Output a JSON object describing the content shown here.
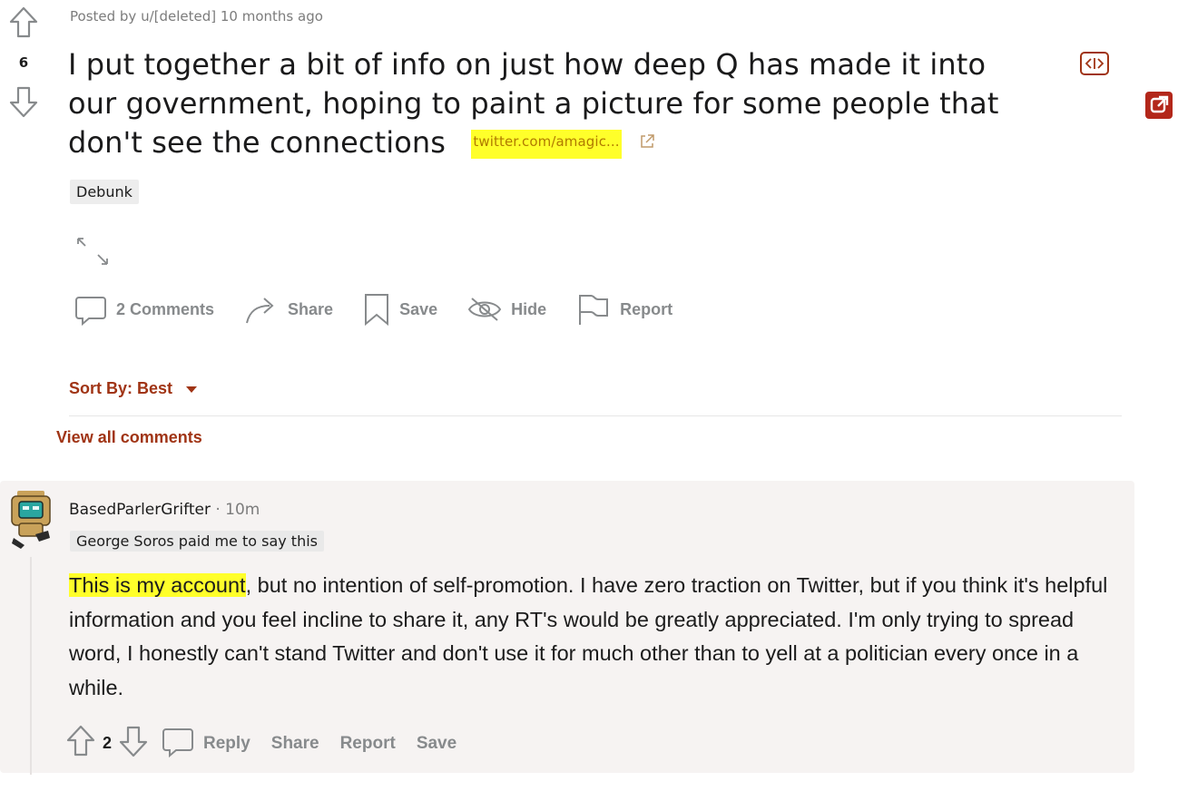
{
  "post": {
    "meta": "Posted by u/[deleted] 10 months ago",
    "score": "6",
    "title": "I put together a bit of info on just how deep Q has made it into our government, hoping to paint a picture for some people that don't see the connections",
    "domain": "twitter.com/amagic...",
    "flair": "Debunk",
    "actions": {
      "comments": "2 Comments",
      "share": "Share",
      "save": "Save",
      "hide": "Hide",
      "report": "Report"
    }
  },
  "sort": {
    "label": "Sort By: Best"
  },
  "view_all": "View all comments",
  "comment": {
    "author": "BasedParlerGrifter",
    "separator": " · ",
    "time": "10m",
    "flair": "George Soros paid me to say this",
    "body_highlight": "This is my account",
    "body_rest": ", but no intention of self-promotion. I have zero traction on Twitter, but if you think it's helpful information and you feel incline to share it, any RT's would be greatly appreciated. I'm only trying to spread word, I honestly can't stand Twitter and don't use it for much other than to yell at a politician every once in a while.",
    "score": "2",
    "actions": {
      "reply": "Reply",
      "share": "Share",
      "report": "Report",
      "save": "Save"
    }
  },
  "colors": {
    "accent": "#a03415",
    "highlight": "#ffff2a",
    "muted": "#878a8c",
    "comment_bg": "#f6f3f2"
  }
}
